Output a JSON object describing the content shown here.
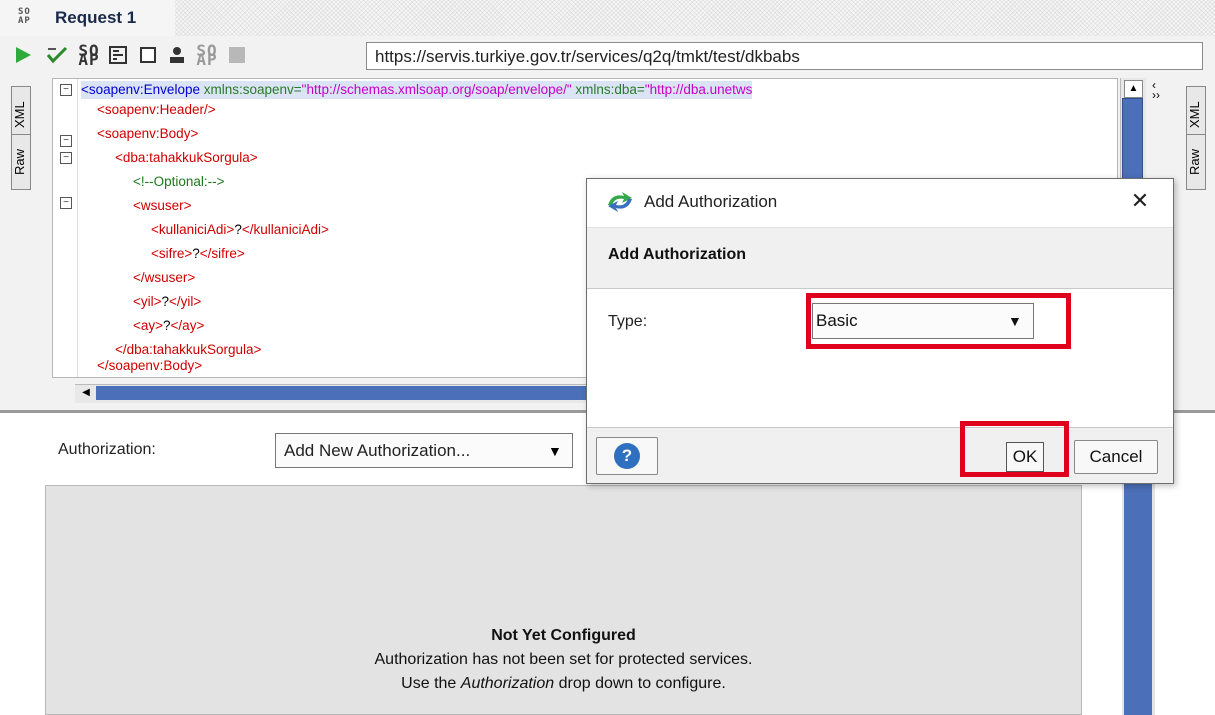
{
  "window": {
    "title": "Request 1",
    "logo_text": "SO AP"
  },
  "toolbar": {
    "url": "https://servis.turkiye.gov.tr/services/q2q/tmkt/test/dkbabs"
  },
  "editor": {
    "tabs": {
      "xml": "XML",
      "raw": "Raw"
    },
    "right_tabs": {
      "xml": "XML",
      "raw": "Raw"
    },
    "lines": [
      "<soapenv:Envelope",
      " xmlns:soapenv=",
      "\"http://schemas.xmlsoap.org/soap/envelope/\"",
      " xmlns:dba=",
      "\"http://dba.unetws"
    ],
    "header_tag": "<soapenv:Header/>",
    "body_open": "<soapenv:Body>",
    "op_open": "<dba:tahakkukSorgula>",
    "comment": "<!--Optional:-->",
    "wsuser_open": "<wsuser>",
    "kullanici": {
      "open": "<kullaniciAdi>",
      "value": "?",
      "close": "</kullaniciAdi>"
    },
    "sifre": {
      "open": "<sifre>",
      "value": "?",
      "close": "</sifre>"
    },
    "wsuser_close": "</wsuser>",
    "yil": {
      "open": "<yil>",
      "value": "?",
      "close": "</yil>"
    },
    "ay": {
      "open": "<ay>",
      "value": "?",
      "close": "</ay>"
    },
    "op_close": "</dba:tahakkukSorgula>",
    "body_close": "</soapenv:Body>"
  },
  "auth_panel": {
    "label": "Authorization:",
    "select_value": "Add New Authorization...",
    "empty_title": "Not Yet Configured",
    "empty_line1": "Authorization has not been set for protected services.",
    "empty_line2_a": "Use the ",
    "empty_line2_em": "Authorization",
    "empty_line2_b": " drop down to configure."
  },
  "dialog": {
    "title": "Add Authorization",
    "heading": "Add Authorization",
    "type_label": "Type:",
    "type_value": "Basic",
    "ok_label": "OK",
    "cancel_label": "Cancel",
    "close_glyph": "✕",
    "help_glyph": "?"
  },
  "colors": {
    "highlight": "#e0001b",
    "scroll_thumb": "#4b6fb8",
    "help_blue": "#2f6fc0"
  },
  "icons": [
    "run-icon",
    "validate-icon",
    "soap-icon",
    "format-icon",
    "checkbox-icon",
    "user-icon",
    "soap-icon",
    "stop-icon",
    "app-icon"
  ]
}
